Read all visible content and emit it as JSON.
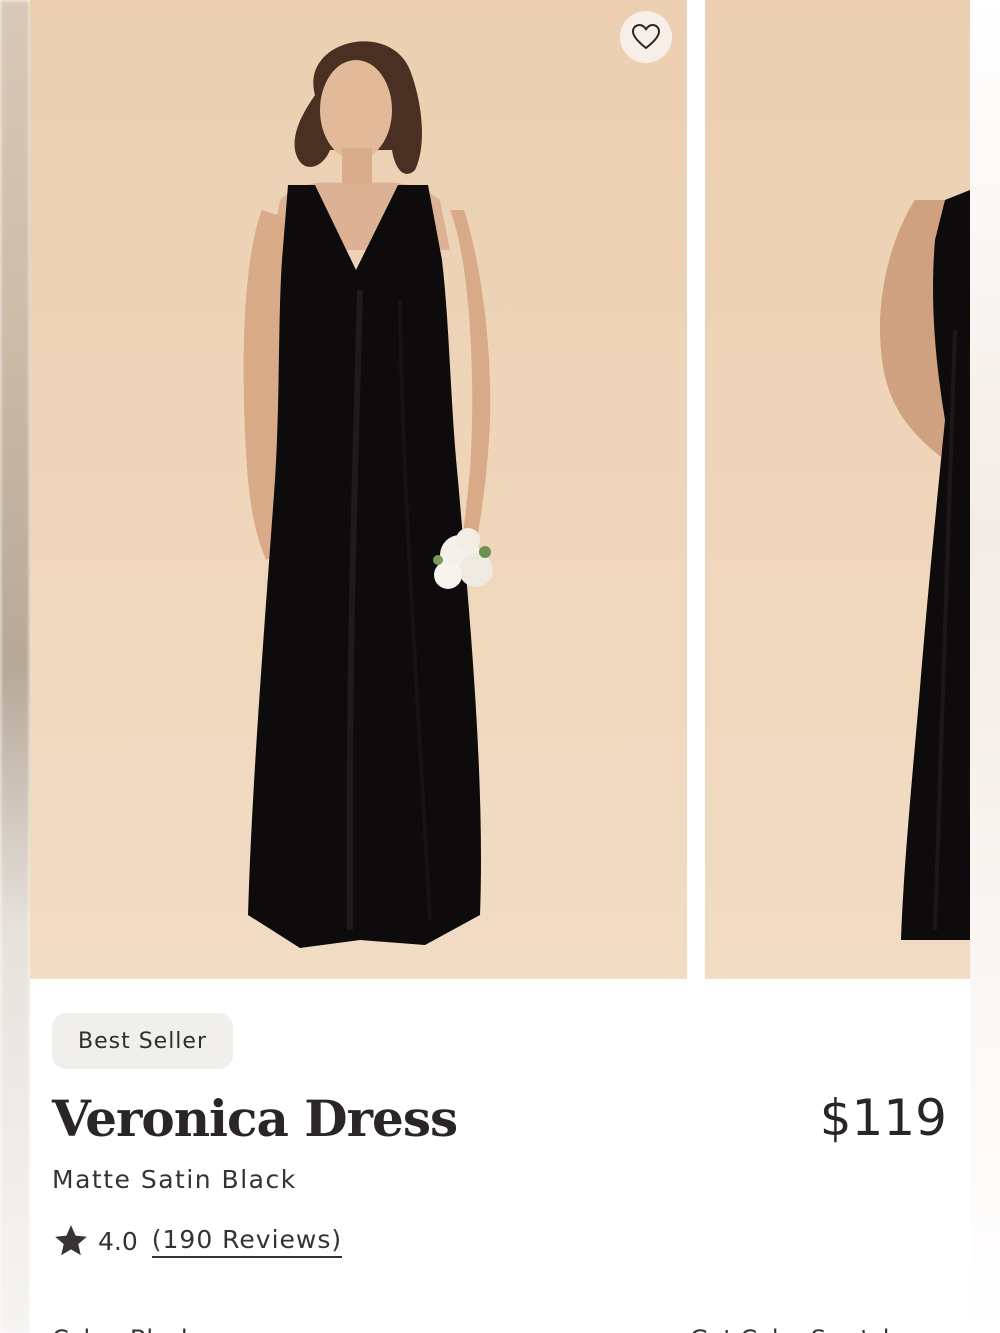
{
  "gallery": {
    "favorite_icon": "heart-icon",
    "images": [
      {
        "alt": "Veronica Dress in Matte Satin Black - front view"
      },
      {
        "alt": "Veronica Dress in Matte Satin Black - side view"
      }
    ]
  },
  "product": {
    "badge": "Best Seller",
    "name": "Veronica Dress",
    "price": "$119",
    "color": "Matte Satin Black",
    "rating_icon": "star-icon",
    "rating": "4.0",
    "reviews_label": "(190 Reviews)"
  },
  "footer_cutoff": {
    "left_text": "Color: Black",
    "right_text": "Get Color Swatch"
  },
  "colors": {
    "photo_background": "#ecd2b5",
    "dress": "#0d0b0b",
    "text": "#2b2626",
    "badge_background": "#f1efec"
  }
}
